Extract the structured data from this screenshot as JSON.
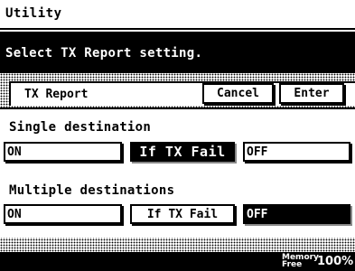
{
  "window": {
    "title": "Utility"
  },
  "message": {
    "text": "Select TX Report setting."
  },
  "tab": {
    "title": "TX Report"
  },
  "actions": {
    "cancel_label": "Cancel",
    "enter_label": "Enter"
  },
  "single_destination": {
    "label": "Single destination",
    "options": [
      "ON",
      "If TX Fail",
      "OFF"
    ],
    "selected": "If TX Fail"
  },
  "multiple_destinations": {
    "label": "Multiple destinations",
    "options": [
      "ON",
      "If TX Fail",
      "OFF"
    ],
    "selected": "OFF"
  },
  "status": {
    "memory_label_line1": "Memory",
    "memory_label_line2": "Free",
    "memory_value": "100%"
  }
}
